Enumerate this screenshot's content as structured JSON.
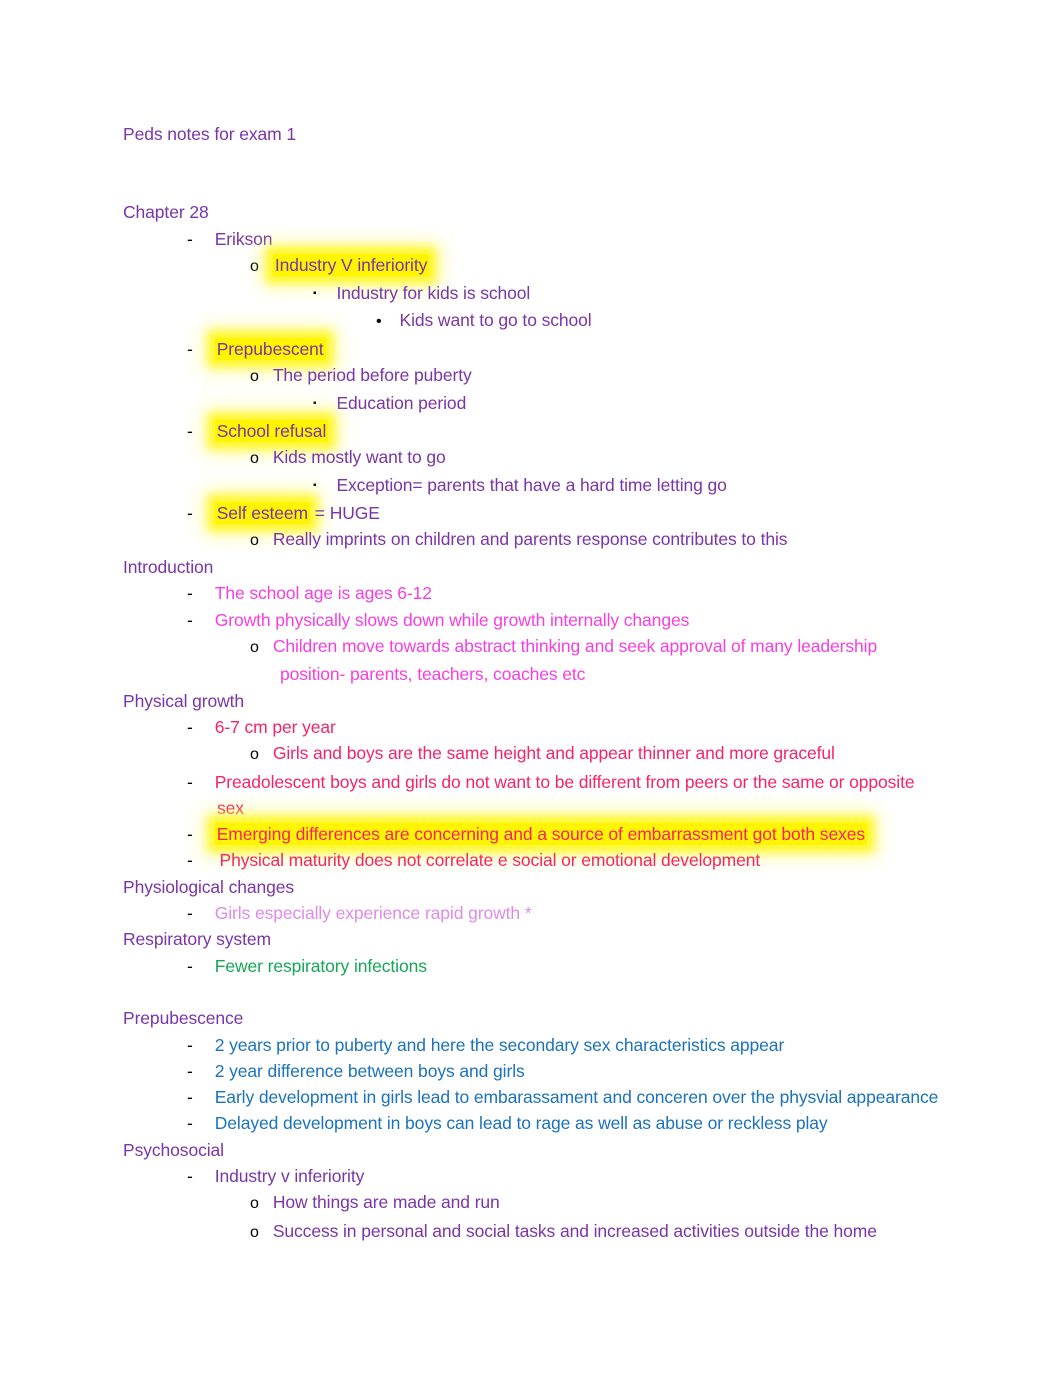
{
  "document": {
    "title": "Peds notes for exam 1"
  },
  "colors": {
    "purple": "#7A35A8",
    "magenta": "#F73FE0",
    "pink": "#F4246B",
    "orchid": "#DD8CE8",
    "green": "#16A755",
    "blue": "#1B72BD",
    "highlight": "#FFF500"
  },
  "markers": {
    "dash": "-",
    "circle": "o",
    "square": "▪",
    "dot": "•"
  },
  "sections": [
    {
      "heading": "Chapter 28",
      "heading_color": "purple",
      "lines": [
        {
          "level": 1,
          "marker": "dash",
          "text": "Erikson",
          "color": "purple",
          "highlight": false
        },
        {
          "level": 2,
          "marker": "circle",
          "text": "Industry V inferiority",
          "color": "purple",
          "highlight": true
        },
        {
          "level": 3,
          "marker": "square",
          "text": "Industry for kids is school",
          "color": "purple",
          "highlight": false
        },
        {
          "level": 4,
          "marker": "dot",
          "text": "Kids want to go to school",
          "color": "purple",
          "highlight": false
        },
        {
          "level": 1,
          "marker": "dash",
          "text": "Prepubescent",
          "color": "purple",
          "highlight": true
        },
        {
          "level": 2,
          "marker": "circle",
          "text": "The period before puberty",
          "color": "purple",
          "highlight": false
        },
        {
          "level": 3,
          "marker": "square",
          "text": "Education period",
          "color": "purple",
          "highlight": false
        },
        {
          "level": 1,
          "marker": "dash",
          "text": "School refusal",
          "color": "purple",
          "highlight": true
        },
        {
          "level": 2,
          "marker": "circle",
          "text": "Kids mostly want to go",
          "color": "purple",
          "highlight": false
        },
        {
          "level": 3,
          "marker": "square",
          "text": "Exception= parents that have a hard time letting go",
          "color": "purple",
          "highlight": false
        },
        {
          "level": 1,
          "marker": "dash",
          "text": "Self esteem",
          "text_after": " = HUGE",
          "color": "purple",
          "highlight": true
        },
        {
          "level": 2,
          "marker": "circle",
          "text": "Really imprints on children and parents response contributes to this",
          "color": "purple",
          "highlight": false
        }
      ]
    },
    {
      "heading": "Introduction",
      "heading_color": "purple",
      "lines": [
        {
          "level": 1,
          "marker": "dash",
          "text": "The school age is ages 6-12",
          "color": "magenta",
          "highlight": false
        },
        {
          "level": 1,
          "marker": "dash",
          "text": "Growth physically slows down while growth internally changes",
          "color": "magenta",
          "highlight": false
        },
        {
          "level": 2,
          "marker": "circle",
          "text": "Children move towards abstract thinking and seek approval of many leadership position- parents, teachers, coaches etc",
          "color": "magenta",
          "highlight": false
        }
      ]
    },
    {
      "heading": "Physical growth",
      "heading_color": "purple",
      "lines": [
        {
          "level": 1,
          "marker": "dash",
          "text": "6-7 cm per year",
          "color": "pink",
          "highlight": false
        },
        {
          "level": 2,
          "marker": "circle",
          "text": "Girls and boys are the same height and appear thinner and more graceful",
          "color": "pink",
          "highlight": false
        },
        {
          "level": 1,
          "marker": "dash",
          "text": "Preadolescent boys and girls do not want to be different from peers or the same or opposite sex",
          "color": "pink",
          "highlight": false
        },
        {
          "level": 1,
          "marker": "dash",
          "text": "Emerging differences are concerning and a source of embarrassment got both sexes",
          "color": "pink",
          "highlight": true
        },
        {
          "level": 1,
          "marker": "dash",
          "text": " Physical maturity does not correlate e social or emotional development",
          "color": "pink",
          "highlight": false
        }
      ]
    },
    {
      "heading": "Physiological changes",
      "heading_color": "purple",
      "lines": [
        {
          "level": 1,
          "marker": "dash",
          "text": "Girls especially experience rapid growth *",
          "color": "orchid",
          "highlight": false
        }
      ]
    },
    {
      "heading": "Respiratory system",
      "heading_color": "purple",
      "lines": [
        {
          "level": 1,
          "marker": "dash",
          "text": "Fewer respiratory infections",
          "color": "green",
          "highlight": false
        }
      ]
    },
    {
      "heading": "Prepubescence",
      "heading_color": "purple",
      "spacer_before": true,
      "lines": [
        {
          "level": 1,
          "marker": "dash",
          "text": "2 years prior to puberty and here the secondary sex characteristics appear",
          "color": "blue",
          "highlight": false
        },
        {
          "level": 1,
          "marker": "dash",
          "text": "2 year difference between boys and girls",
          "color": "blue",
          "highlight": false
        },
        {
          "level": 1,
          "marker": "dash",
          "text": "Early development in girls lead to embarassament and conceren over the physvial appearance",
          "color": "blue",
          "highlight": false
        },
        {
          "level": 1,
          "marker": "dash",
          "text": "Delayed development in boys can lead to rage as well as abuse or reckless play",
          "color": "blue",
          "highlight": false
        }
      ]
    },
    {
      "heading": "Psychosocial",
      "heading_color": "purple",
      "lines": [
        {
          "level": 1,
          "marker": "dash",
          "text": "Industry v inferiority",
          "color": "purple",
          "highlight": false
        },
        {
          "level": 2,
          "marker": "circle",
          "text": "How things are made and run",
          "color": "purple",
          "highlight": false
        },
        {
          "level": 2,
          "marker": "circle",
          "text": "Success in personal and social tasks and increased activities outside the home",
          "color": "purple",
          "highlight": false
        }
      ]
    }
  ]
}
